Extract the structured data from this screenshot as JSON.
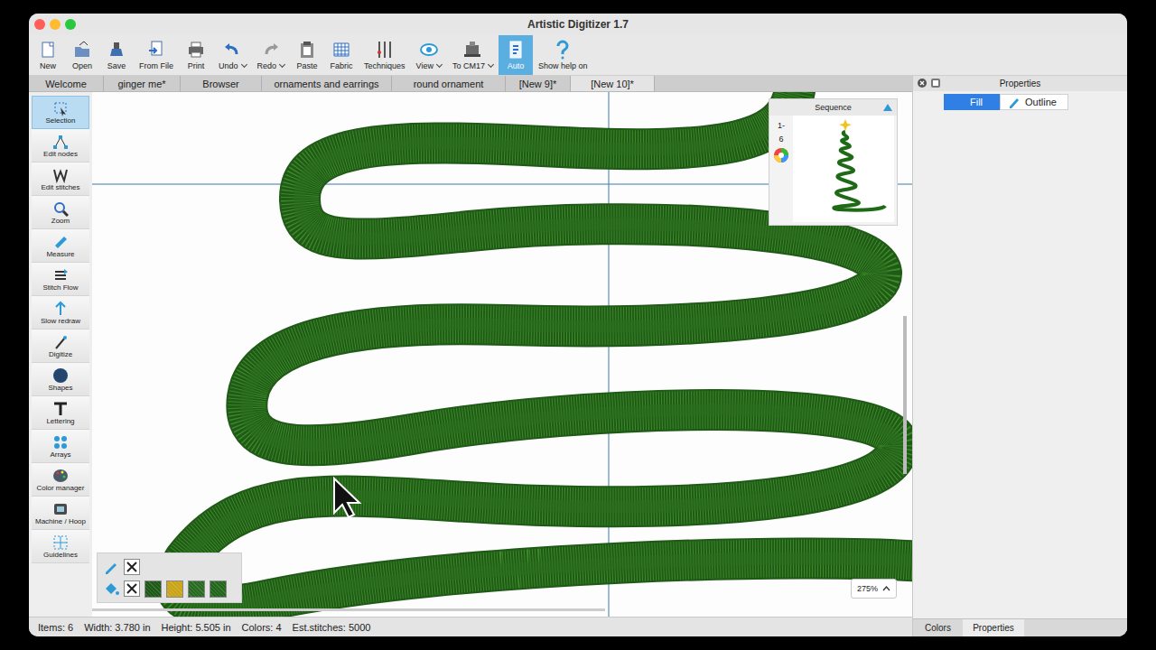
{
  "window": {
    "title": "Artistic Digitizer 1.7"
  },
  "toolbar": [
    {
      "label": "New",
      "selected": false,
      "menu": false
    },
    {
      "label": "Open",
      "selected": false,
      "menu": false
    },
    {
      "label": "Save",
      "selected": false,
      "menu": false
    },
    {
      "label": "From File",
      "selected": false,
      "menu": false
    },
    {
      "label": "Print",
      "selected": false,
      "menu": false
    },
    {
      "label": "Undo",
      "selected": false,
      "menu": true
    },
    {
      "label": "Redo",
      "selected": false,
      "menu": true
    },
    {
      "label": "Paste",
      "selected": false,
      "menu": false
    },
    {
      "label": "Fabric",
      "selected": false,
      "menu": false
    },
    {
      "label": "Techniques",
      "selected": false,
      "menu": false
    },
    {
      "label": "View",
      "selected": false,
      "menu": true
    },
    {
      "label": "To CM17",
      "selected": false,
      "menu": true
    },
    {
      "label": "Auto",
      "selected": true,
      "menu": false
    },
    {
      "label": "Show help on",
      "selected": false,
      "menu": false
    }
  ],
  "tabs": [
    {
      "label": "Welcome",
      "selected": false
    },
    {
      "label": "ginger me*",
      "selected": false
    },
    {
      "label": "Browser",
      "selected": false
    },
    {
      "label": "ornaments and earrings",
      "selected": false
    },
    {
      "label": "round ornament",
      "selected": false
    },
    {
      "label": "[New 9]*",
      "selected": false
    },
    {
      "label": "[New 10]*",
      "selected": true
    }
  ],
  "tools": [
    {
      "label": "Selection",
      "selected": true
    },
    {
      "label": "Edit nodes",
      "selected": false
    },
    {
      "label": "Edit stitches",
      "selected": false
    },
    {
      "label": "Zoom",
      "selected": false
    },
    {
      "label": "Measure",
      "selected": false
    },
    {
      "label": "Stitch Flow",
      "selected": false
    },
    {
      "label": "Slow redraw",
      "selected": false
    },
    {
      "label": "Digitize",
      "selected": false
    },
    {
      "label": "Shapes",
      "selected": false
    },
    {
      "label": "Lettering",
      "selected": false
    },
    {
      "label": "Arrays",
      "selected": false
    },
    {
      "label": "Color manager",
      "selected": false
    },
    {
      "label": "Machine / Hoop",
      "selected": false
    },
    {
      "label": "Guidelines",
      "selected": false
    }
  ],
  "sequence": {
    "title": "Sequence",
    "numbers": [
      "1-",
      "6"
    ]
  },
  "zoom": {
    "value": "275%"
  },
  "palette": {
    "swatches": [
      {
        "color": "#1d5a17"
      },
      {
        "color": "#c9a416"
      },
      {
        "color": "#286b20"
      },
      {
        "color": "#22661c"
      }
    ]
  },
  "status_bar": [
    "Items: 6",
    "Width: 3.780 in",
    "Height: 5.505 in",
    "Colors: 4",
    "Est.stitches: 5000"
  ],
  "properties": {
    "title": "Properties",
    "tabs": [
      {
        "label": "Fill",
        "selected": true
      },
      {
        "label": "Outline",
        "selected": false
      }
    ]
  },
  "bottom_tabs": [
    {
      "label": "Colors",
      "selected": false
    },
    {
      "label": "Properties",
      "selected": true
    }
  ]
}
